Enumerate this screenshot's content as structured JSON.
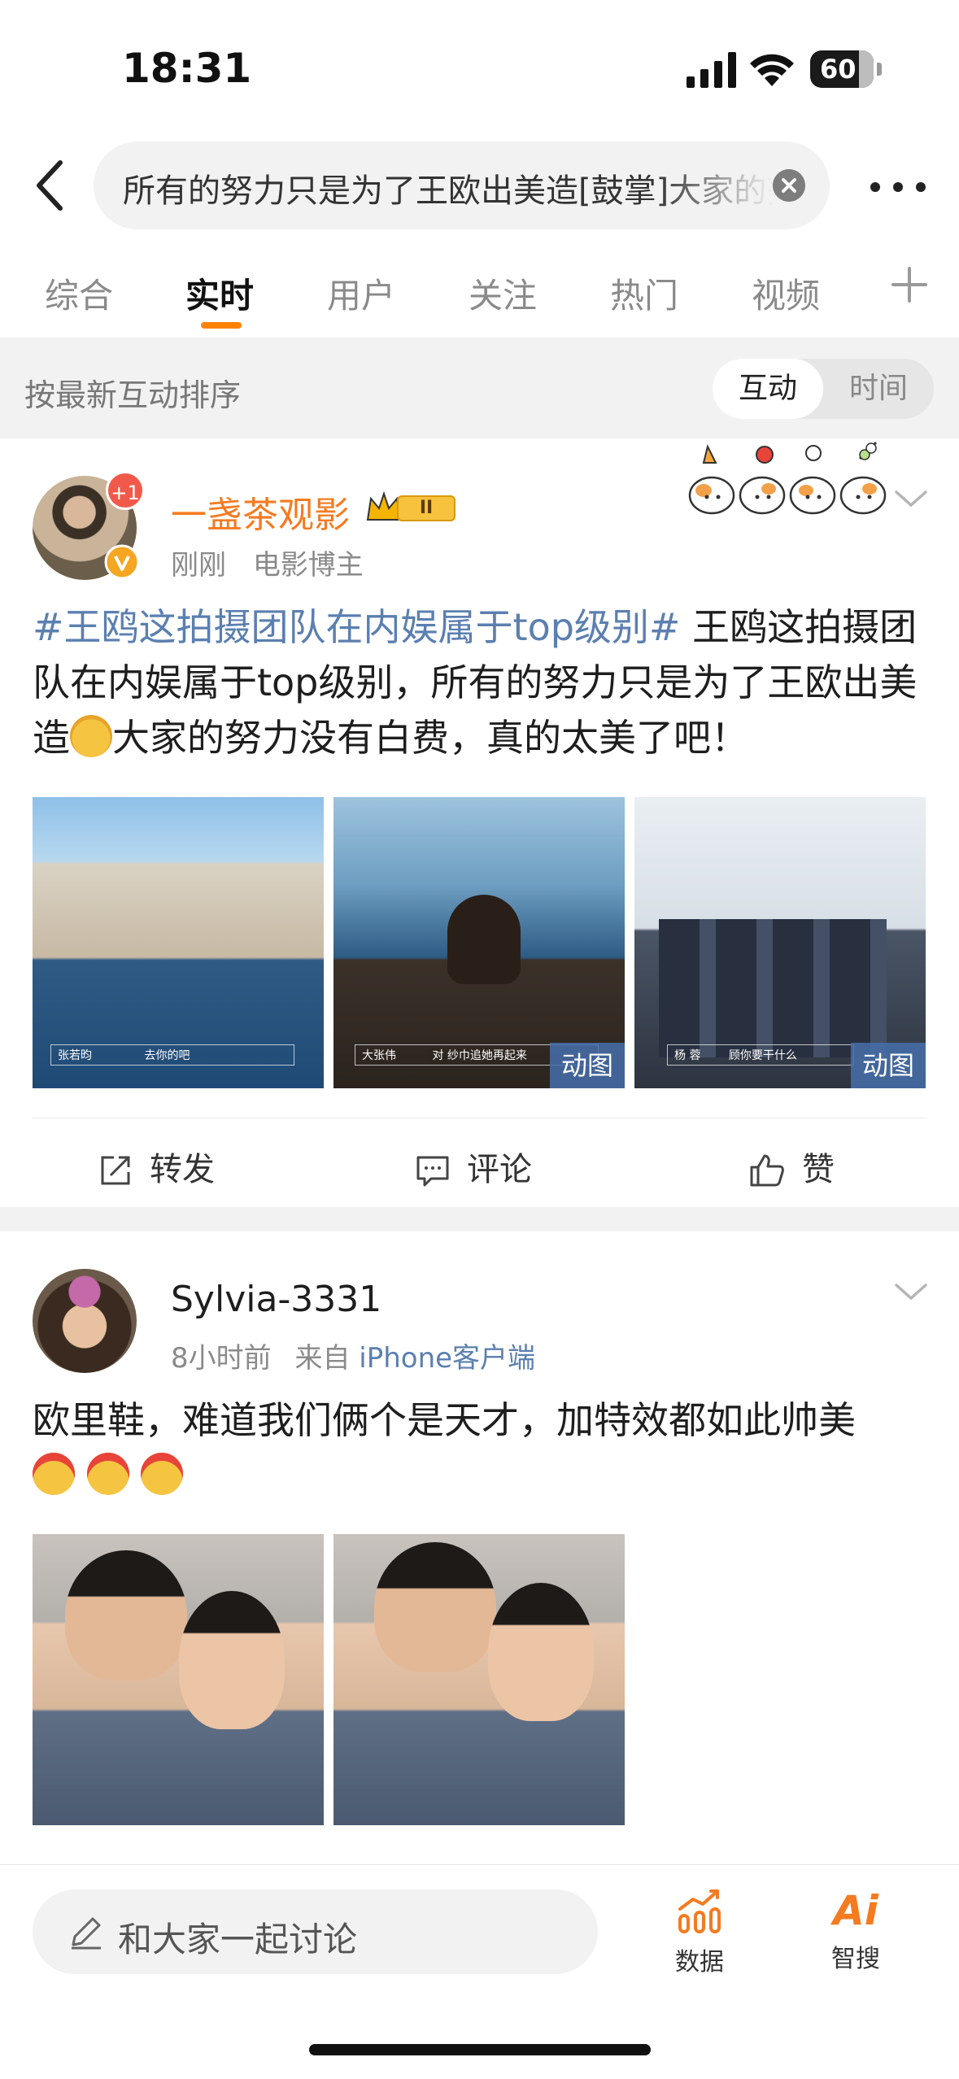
{
  "status_bar": {
    "time": "18:31",
    "battery": "60"
  },
  "search": {
    "query": "所有的努力只是为了王欧出美造[鼓掌]大家的努力"
  },
  "tabs": [
    {
      "label": "综合"
    },
    {
      "label": "实时"
    },
    {
      "label": "用户"
    },
    {
      "label": "关注"
    },
    {
      "label": "热门"
    },
    {
      "label": "视频"
    }
  ],
  "active_tab": "实时",
  "sort_bar": {
    "label": "按最新互动排序",
    "option_active": "互动",
    "option_other": "时间"
  },
  "posts": [
    {
      "avatar_badge": "+1",
      "username": "一盏茶观影",
      "level": "II",
      "meta_time": "刚刚",
      "meta_tag": "电影博主",
      "topic": "#王鸥这拍摄团队在内娱属于top级别#",
      "text_before_emoji": " 王鸥这拍摄团队在内娱属于top级别，所有的努力只是为了王欧出美造",
      "text_after_emoji": "大家的努力没有白费，真的太美了吧！",
      "images": [
        {
          "caption_name": "张若昀",
          "caption_line": "去你的吧",
          "gif_label": ""
        },
        {
          "caption_name": "大张伟",
          "caption_line": "对 纱巾追她再起来",
          "gif_label": "动图"
        },
        {
          "caption_name": "杨 蓉",
          "caption_line": "顾你要干什么",
          "gif_label": "动图"
        }
      ],
      "actions": {
        "repost": "转发",
        "comment": "评论",
        "like": "赞"
      }
    },
    {
      "username": "Sylvia-3331",
      "meta_time": "8小时前",
      "meta_from": "来自",
      "meta_source": "iPhone客户端",
      "text": "欧里鞋，难道我们俩个是天才，加特效都如此帅美",
      "emoji_count": 3
    }
  ],
  "bottom_bar": {
    "discuss_placeholder": "和大家一起讨论",
    "data_label": "数据",
    "ai_label": "智搜",
    "ai_icon_text": "Ai"
  },
  "colors": {
    "accent": "#ff8200",
    "link": "#5b7fb0",
    "username_orange": "#f47b20"
  }
}
